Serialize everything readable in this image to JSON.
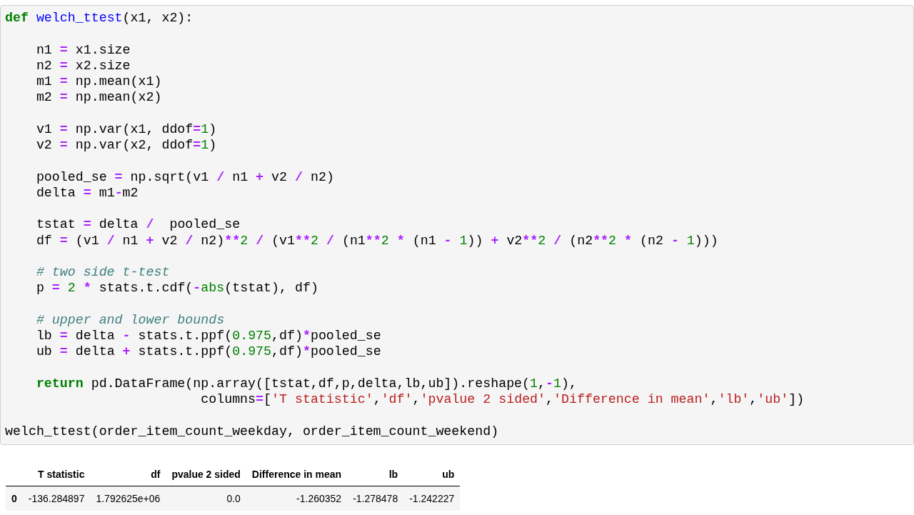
{
  "code_cell": {
    "blocks": [
      [
        [
          {
            "kind": "keyword",
            "text": "def "
          },
          {
            "kind": "function",
            "text": "welch_ttest"
          },
          {
            "kind": "plain",
            "text": "(x1, x2):"
          }
        ]
      ],
      [
        [
          {
            "kind": "plain",
            "text": "    n1 "
          },
          {
            "kind": "operator",
            "text": "="
          },
          {
            "kind": "plain",
            "text": " x1.size"
          }
        ],
        [
          {
            "kind": "plain",
            "text": "    n2 "
          },
          {
            "kind": "operator",
            "text": "="
          },
          {
            "kind": "plain",
            "text": " x2.size"
          }
        ],
        [
          {
            "kind": "plain",
            "text": "    m1 "
          },
          {
            "kind": "operator",
            "text": "="
          },
          {
            "kind": "plain",
            "text": " np.mean(x1)"
          }
        ],
        [
          {
            "kind": "plain",
            "text": "    m2 "
          },
          {
            "kind": "operator",
            "text": "="
          },
          {
            "kind": "plain",
            "text": " np.mean(x2)"
          }
        ]
      ],
      [
        [
          {
            "kind": "plain",
            "text": "    v1 "
          },
          {
            "kind": "operator",
            "text": "="
          },
          {
            "kind": "plain",
            "text": " np.var(x1, ddof"
          },
          {
            "kind": "operator",
            "text": "="
          },
          {
            "kind": "number",
            "text": "1"
          },
          {
            "kind": "plain",
            "text": ")"
          }
        ],
        [
          {
            "kind": "plain",
            "text": "    v2 "
          },
          {
            "kind": "operator",
            "text": "="
          },
          {
            "kind": "plain",
            "text": " np.var(x2, ddof"
          },
          {
            "kind": "operator",
            "text": "="
          },
          {
            "kind": "number",
            "text": "1"
          },
          {
            "kind": "plain",
            "text": ")"
          }
        ]
      ],
      [
        [
          {
            "kind": "plain",
            "text": "    pooled_se "
          },
          {
            "kind": "operator",
            "text": "="
          },
          {
            "kind": "plain",
            "text": " np.sqrt(v1 "
          },
          {
            "kind": "operator",
            "text": "/"
          },
          {
            "kind": "plain",
            "text": " n1 "
          },
          {
            "kind": "operator",
            "text": "+"
          },
          {
            "kind": "plain",
            "text": " v2 "
          },
          {
            "kind": "operator",
            "text": "/"
          },
          {
            "kind": "plain",
            "text": " n2)"
          }
        ],
        [
          {
            "kind": "plain",
            "text": "    delta "
          },
          {
            "kind": "operator",
            "text": "="
          },
          {
            "kind": "plain",
            "text": " m1"
          },
          {
            "kind": "operator",
            "text": "-"
          },
          {
            "kind": "plain",
            "text": "m2"
          }
        ]
      ],
      [
        [
          {
            "kind": "plain",
            "text": "    tstat "
          },
          {
            "kind": "operator",
            "text": "="
          },
          {
            "kind": "plain",
            "text": " delta "
          },
          {
            "kind": "operator",
            "text": "/"
          },
          {
            "kind": "plain",
            "text": "  pooled_se"
          }
        ],
        [
          {
            "kind": "plain",
            "text": "    df "
          },
          {
            "kind": "operator",
            "text": "="
          },
          {
            "kind": "plain",
            "text": " (v1 "
          },
          {
            "kind": "operator",
            "text": "/"
          },
          {
            "kind": "plain",
            "text": " n1 "
          },
          {
            "kind": "operator",
            "text": "+"
          },
          {
            "kind": "plain",
            "text": " v2 "
          },
          {
            "kind": "operator",
            "text": "/"
          },
          {
            "kind": "plain",
            "text": " n2)"
          },
          {
            "kind": "operator",
            "text": "**"
          },
          {
            "kind": "number",
            "text": "2"
          },
          {
            "kind": "operator",
            "text": " / "
          },
          {
            "kind": "plain",
            "text": "(v1"
          },
          {
            "kind": "operator",
            "text": "**"
          },
          {
            "kind": "number",
            "text": "2"
          },
          {
            "kind": "operator",
            "text": " / "
          },
          {
            "kind": "plain",
            "text": "(n1"
          },
          {
            "kind": "operator",
            "text": "**"
          },
          {
            "kind": "number",
            "text": "2"
          },
          {
            "kind": "operator",
            "text": " * "
          },
          {
            "kind": "plain",
            "text": "(n1 "
          },
          {
            "kind": "operator",
            "text": "- "
          },
          {
            "kind": "number",
            "text": "1"
          },
          {
            "kind": "plain",
            "text": ")) "
          },
          {
            "kind": "operator",
            "text": "+"
          },
          {
            "kind": "plain",
            "text": " v2"
          },
          {
            "kind": "operator",
            "text": "**"
          },
          {
            "kind": "number",
            "text": "2"
          },
          {
            "kind": "operator",
            "text": " / "
          },
          {
            "kind": "plain",
            "text": "(n2"
          },
          {
            "kind": "operator",
            "text": "**"
          },
          {
            "kind": "number",
            "text": "2"
          },
          {
            "kind": "operator",
            "text": " * "
          },
          {
            "kind": "plain",
            "text": "(n2 "
          },
          {
            "kind": "operator",
            "text": "- "
          },
          {
            "kind": "number",
            "text": "1"
          },
          {
            "kind": "plain",
            "text": ")))"
          }
        ]
      ],
      [
        [
          {
            "kind": "comment",
            "text": "    # two side t-test"
          }
        ],
        [
          {
            "kind": "plain",
            "text": "    p "
          },
          {
            "kind": "operator",
            "text": "= "
          },
          {
            "kind": "number",
            "text": "2"
          },
          {
            "kind": "operator",
            "text": " * "
          },
          {
            "kind": "plain",
            "text": "stats.t.cdf("
          },
          {
            "kind": "operator",
            "text": "-"
          },
          {
            "kind": "builtin",
            "text": "abs"
          },
          {
            "kind": "plain",
            "text": "(tstat), df)"
          }
        ]
      ],
      [
        [
          {
            "kind": "comment",
            "text": "    # upper and lower bounds"
          }
        ],
        [
          {
            "kind": "plain",
            "text": "    lb "
          },
          {
            "kind": "operator",
            "text": "="
          },
          {
            "kind": "plain",
            "text": " delta "
          },
          {
            "kind": "operator",
            "text": "-"
          },
          {
            "kind": "plain",
            "text": " stats.t.ppf("
          },
          {
            "kind": "number",
            "text": "0.975"
          },
          {
            "kind": "plain",
            "text": ",df)"
          },
          {
            "kind": "operator",
            "text": "*"
          },
          {
            "kind": "plain",
            "text": "pooled_se"
          }
        ],
        [
          {
            "kind": "plain",
            "text": "    ub "
          },
          {
            "kind": "operator",
            "text": "="
          },
          {
            "kind": "plain",
            "text": " delta "
          },
          {
            "kind": "operator",
            "text": "+"
          },
          {
            "kind": "plain",
            "text": " stats.t.ppf("
          },
          {
            "kind": "number",
            "text": "0.975"
          },
          {
            "kind": "plain",
            "text": ",df)"
          },
          {
            "kind": "operator",
            "text": "*"
          },
          {
            "kind": "plain",
            "text": "pooled_se"
          }
        ]
      ],
      [
        [
          {
            "kind": "keyword",
            "text": "    return"
          },
          {
            "kind": "plain",
            "text": " pd.DataFrame(np.array([tstat,df,p,delta,lb,ub]).reshape("
          },
          {
            "kind": "number",
            "text": "1"
          },
          {
            "kind": "plain",
            "text": ","
          },
          {
            "kind": "operator",
            "text": "-"
          },
          {
            "kind": "number",
            "text": "1"
          },
          {
            "kind": "plain",
            "text": "),"
          }
        ],
        [
          {
            "kind": "plain",
            "text": "                         columns"
          },
          {
            "kind": "operator",
            "text": "="
          },
          {
            "kind": "plain",
            "text": "["
          },
          {
            "kind": "string",
            "text": "'T statistic'"
          },
          {
            "kind": "plain",
            "text": ","
          },
          {
            "kind": "string",
            "text": "'df'"
          },
          {
            "kind": "plain",
            "text": ","
          },
          {
            "kind": "string",
            "text": "'pvalue 2 sided'"
          },
          {
            "kind": "plain",
            "text": ","
          },
          {
            "kind": "string",
            "text": "'Difference in mean'"
          },
          {
            "kind": "plain",
            "text": ","
          },
          {
            "kind": "string",
            "text": "'lb'"
          },
          {
            "kind": "plain",
            "text": ","
          },
          {
            "kind": "string",
            "text": "'ub'"
          },
          {
            "kind": "plain",
            "text": "])"
          }
        ]
      ],
      [
        [
          {
            "kind": "plain",
            "text": "welch_ttest(order_item_count_weekday, order_item_count_weekend)"
          }
        ]
      ]
    ]
  },
  "output_table": {
    "columns": [
      "T statistic",
      "df",
      "pvalue 2 sided",
      "Difference in mean",
      "lb",
      "ub"
    ],
    "rows": [
      {
        "index": "0",
        "cells": [
          "-136.284897",
          "1.792625e+06",
          "0.0",
          "-1.260352",
          "-1.278478",
          "-1.242227"
        ]
      }
    ]
  }
}
